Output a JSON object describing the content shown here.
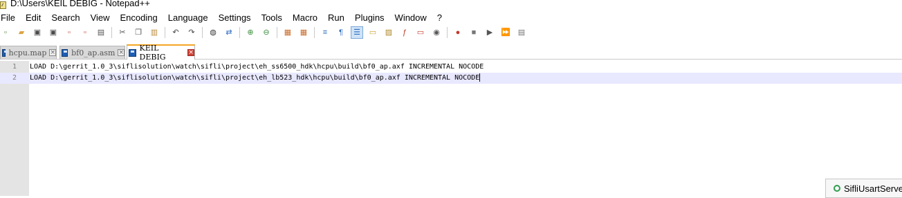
{
  "window": {
    "title": "D:\\Users\\KEIL DEBIG - Notepad++",
    "app_icon": "notepad-icon"
  },
  "menubar": {
    "items": [
      "File",
      "Edit",
      "Search",
      "View",
      "Encoding",
      "Language",
      "Settings",
      "Tools",
      "Macro",
      "Run",
      "Plugins",
      "Window",
      "?"
    ]
  },
  "toolbar": {
    "buttons": [
      {
        "name": "new-file-icon",
        "glyph": "▫",
        "color": "#5a8f3c"
      },
      {
        "name": "open-file-icon",
        "glyph": "▰",
        "color": "#d9a441"
      },
      {
        "name": "save-icon",
        "glyph": "▣",
        "color": "#4a4a4a"
      },
      {
        "name": "save-all-icon",
        "glyph": "▣",
        "color": "#4a4a4a"
      },
      {
        "name": "close-file-icon",
        "glyph": "▫",
        "color": "#c94a3a"
      },
      {
        "name": "close-all-icon",
        "glyph": "▫",
        "color": "#c94a3a"
      },
      {
        "name": "print-icon",
        "glyph": "▤",
        "color": "#555"
      },
      {
        "sep": true
      },
      {
        "name": "cut-icon",
        "glyph": "✂",
        "color": "#555"
      },
      {
        "name": "copy-icon",
        "glyph": "❐",
        "color": "#555"
      },
      {
        "name": "paste-icon",
        "glyph": "▥",
        "color": "#b88a3a"
      },
      {
        "sep": true
      },
      {
        "name": "undo-icon",
        "glyph": "↶",
        "color": "#444"
      },
      {
        "name": "redo-icon",
        "glyph": "↷",
        "color": "#444"
      },
      {
        "sep": true
      },
      {
        "name": "find-icon",
        "glyph": "◍",
        "color": "#333"
      },
      {
        "name": "replace-icon",
        "glyph": "⇄",
        "color": "#2d6bbf"
      },
      {
        "sep": true
      },
      {
        "name": "zoom-in-icon",
        "glyph": "⊕",
        "color": "#3a8a3a"
      },
      {
        "name": "zoom-out-icon",
        "glyph": "⊖",
        "color": "#3a8a3a"
      },
      {
        "sep": true
      },
      {
        "name": "sync-vertical-icon",
        "glyph": "▦",
        "color": "#c96b2a"
      },
      {
        "name": "sync-horizontal-icon",
        "glyph": "▦",
        "color": "#c96b2a"
      },
      {
        "sep": true
      },
      {
        "name": "word-wrap-icon",
        "glyph": "≡",
        "color": "#2d6bbf"
      },
      {
        "name": "show-all-chars-icon",
        "glyph": "¶",
        "color": "#2d6bbf"
      },
      {
        "name": "indent-guide-icon",
        "glyph": "☰",
        "color": "#2d6bbf",
        "active": true
      },
      {
        "name": "user-defined-lang-icon",
        "glyph": "▭",
        "color": "#c9a02a"
      },
      {
        "name": "doc-map-icon",
        "glyph": "▨",
        "color": "#b08a2a"
      },
      {
        "name": "function-list-icon",
        "glyph": "ƒ",
        "color": "#c0392b"
      },
      {
        "name": "folder-workspace-icon",
        "glyph": "▭",
        "color": "#c0392b"
      },
      {
        "name": "monitoring-icon",
        "glyph": "◉",
        "color": "#555"
      },
      {
        "sep": true
      },
      {
        "name": "record-macro-icon",
        "glyph": "●",
        "color": "#c0392b"
      },
      {
        "name": "stop-macro-icon",
        "glyph": "■",
        "color": "#777"
      },
      {
        "name": "play-macro-icon",
        "glyph": "▶",
        "color": "#555"
      },
      {
        "name": "run-macro-multiple-icon",
        "glyph": "⏩",
        "color": "#2d6bbf"
      },
      {
        "name": "save-macro-icon",
        "glyph": "▤",
        "color": "#777"
      }
    ]
  },
  "tabs": [
    {
      "label": "hcpu.map",
      "active": false
    },
    {
      "label": "bf0_ap.asm",
      "active": false
    },
    {
      "label": "KEIL DEBIG",
      "active": true
    }
  ],
  "editor": {
    "lines": [
      {
        "num": "1",
        "text": "LOAD D:\\gerrit_1.0_3\\siflisolution\\watch\\sifli\\project\\eh_ss6500_hdk\\hcpu\\build\\bf0_ap.axf INCREMENTAL NOCODE"
      },
      {
        "num": "2",
        "text": "LOAD D:\\gerrit_1.0_3\\siflisolution\\watch\\sifli\\project\\eh_lb523_hdk\\hcpu\\build\\bf0_ap.axf INCREMENTAL NOCODE"
      }
    ],
    "current_line_index": 1
  },
  "notification": {
    "icon": "network-icon",
    "label": "SifliUsartServe"
  }
}
